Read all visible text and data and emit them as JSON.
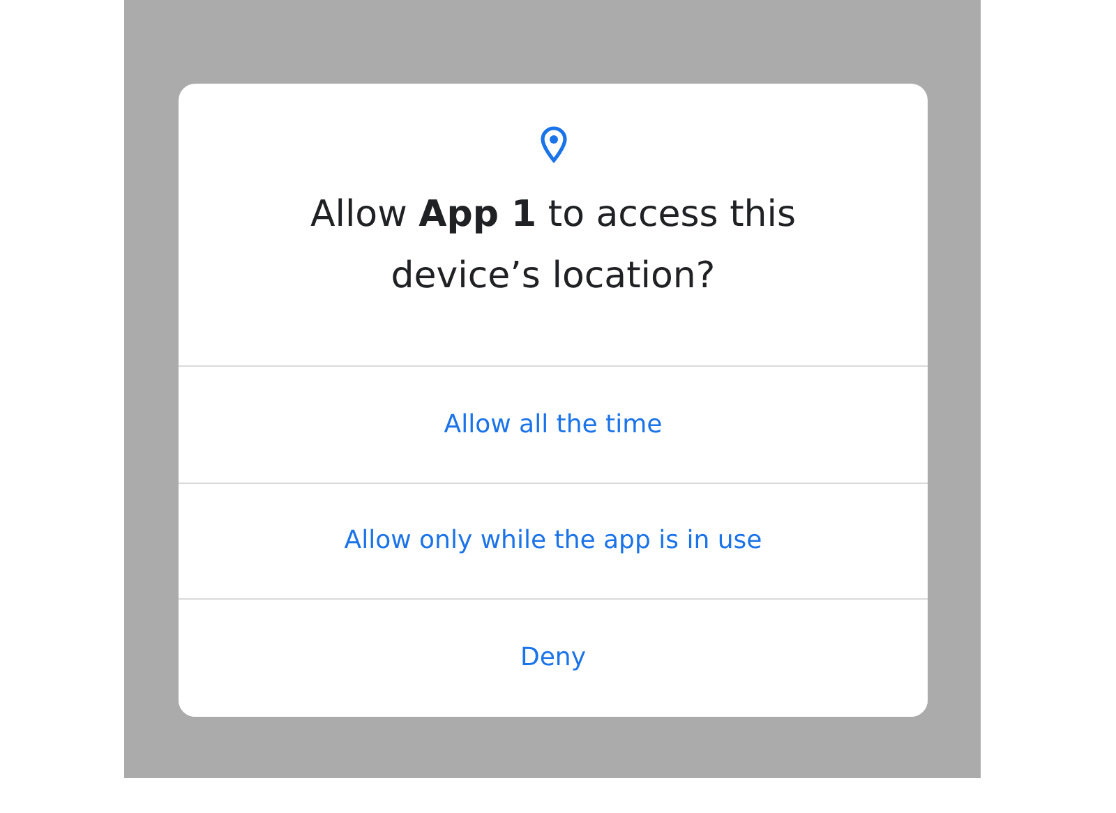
{
  "dialog": {
    "title": "Allow **App 1** to access this device’s location?",
    "buttons": [
      {
        "label": "Allow all the time"
      },
      {
        "label": "Allow only while the app is in use"
      },
      {
        "label": "Deny"
      }
    ]
  }
}
